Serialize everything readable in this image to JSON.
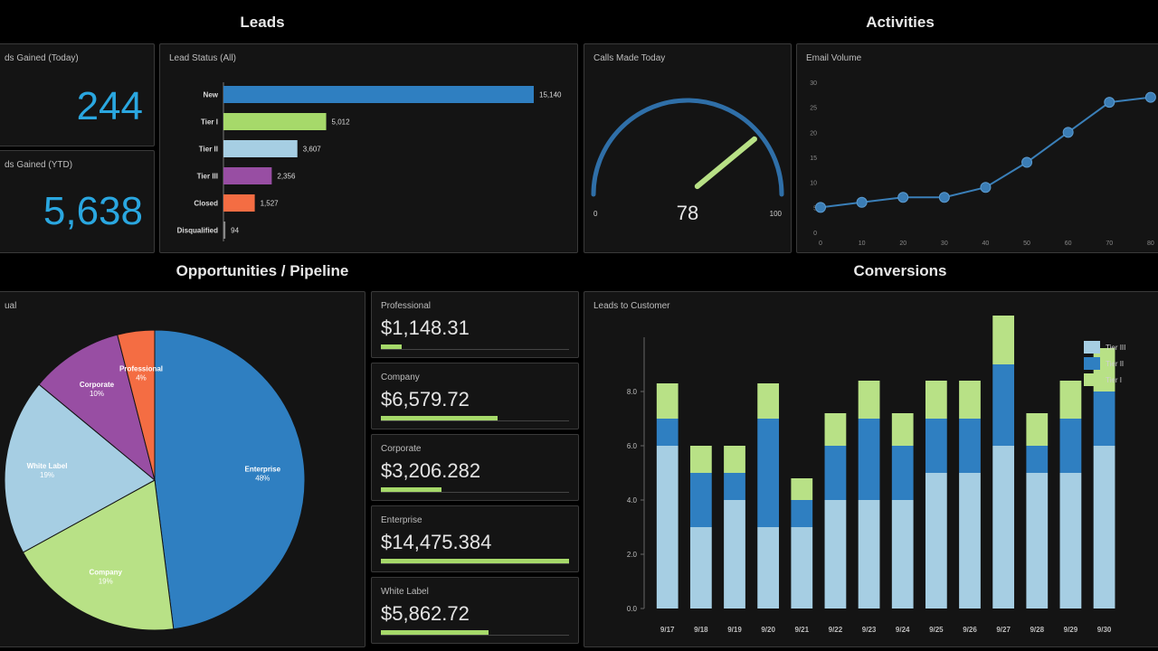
{
  "sections": {
    "leads": "Leads",
    "activities": "Activities",
    "opportunities": "Opportunities / Pipeline",
    "conversions": "Conversions"
  },
  "kpis": {
    "today_title": "ds Gained (Today)",
    "today_value": "244",
    "ytd_title": "ds Gained (YTD)",
    "ytd_value": "5,638"
  },
  "lead_status": {
    "title": "Lead Status (All)",
    "chart_data": {
      "type": "bar",
      "orientation": "horizontal",
      "categories": [
        "New",
        "Tier I",
        "Tier II",
        "Tier III",
        "Closed",
        "Disqualified"
      ],
      "values": [
        15140,
        5012,
        3607,
        2356,
        1527,
        94
      ],
      "value_labels": [
        "15,140",
        "5,012",
        "3,607",
        "2,356",
        "1,527",
        "94"
      ],
      "colors": [
        "#2f7fc1",
        "#a6d96a",
        "#a6cee3",
        "#984ea3",
        "#f46d43",
        "#888888"
      ]
    }
  },
  "calls": {
    "title": "Calls Made Today",
    "chart_data": {
      "type": "gauge",
      "value": 78,
      "min": 0,
      "max": 100,
      "min_label": "0",
      "max_label": "100",
      "value_label": "78"
    }
  },
  "email": {
    "title": "Email Volume",
    "chart_data": {
      "type": "line",
      "x": [
        0,
        10,
        20,
        30,
        40,
        50,
        60,
        70,
        80
      ],
      "x_tick_labels": [
        "0",
        "10",
        "20",
        "30",
        "40",
        "50",
        "60",
        "70",
        "80"
      ],
      "y_tick_labels": [
        "0",
        "5",
        "10",
        "15",
        "20",
        "25",
        "30"
      ],
      "ylim": [
        0,
        30
      ],
      "points": [
        {
          "x": 0,
          "y": 5
        },
        {
          "x": 10,
          "y": 6
        },
        {
          "x": 20,
          "y": 7
        },
        {
          "x": 30,
          "y": 7
        },
        {
          "x": 40,
          "y": 9
        },
        {
          "x": 50,
          "y": 14
        },
        {
          "x": 60,
          "y": 20
        },
        {
          "x": 70,
          "y": 26
        },
        {
          "x": 80,
          "y": 27
        }
      ]
    }
  },
  "pipeline_pie": {
    "title": "ual",
    "chart_data": {
      "type": "pie",
      "slices": [
        {
          "name": "Enterprise",
          "label": "Enterprise",
          "pct_label": "48%",
          "value": 48,
          "color": "#2f7fc1"
        },
        {
          "name": "Company",
          "label": "Company",
          "pct_label": "19%",
          "value": 19,
          "color": "#b8e186"
        },
        {
          "name": "White Label",
          "label": "White Label",
          "pct_label": "19%",
          "value": 19,
          "color": "#a6cee3"
        },
        {
          "name": "Corporate",
          "label": "Corporate",
          "pct_label": "10%",
          "value": 10,
          "color": "#984ea3"
        },
        {
          "name": "Professional",
          "label": "Professional",
          "pct_label": "4%",
          "value": 4,
          "color": "#f46d43"
        }
      ]
    }
  },
  "opportunities": [
    {
      "label": "Professional",
      "value": "$1,148.31",
      "fill": 0.11
    },
    {
      "label": "Company",
      "value": "$6,579.72",
      "fill": 0.62
    },
    {
      "label": "Corporate",
      "value": "$3,206.282",
      "fill": 0.32
    },
    {
      "label": "Enterprise",
      "value": "$14,475.384",
      "fill": 1.0
    },
    {
      "label": "White Label",
      "value": "$5,862.72",
      "fill": 0.57
    }
  ],
  "conversions": {
    "title": "Leads to Customer",
    "chart_data": {
      "type": "bar",
      "stacked": true,
      "categories": [
        "9/17",
        "9/18",
        "9/19",
        "9/20",
        "9/21",
        "9/22",
        "9/23",
        "9/24",
        "9/25",
        "9/26",
        "9/27",
        "9/28",
        "9/29",
        "9/30"
      ],
      "ylim": [
        0,
        10
      ],
      "y_tick_labels": [
        "0.0",
        "2.0",
        "4.0",
        "6.0",
        "8.0"
      ],
      "y_ticks": [
        0,
        2,
        4,
        6,
        8
      ],
      "series": [
        {
          "name": "Tier III",
          "color": "#a6cee3",
          "values": [
            6,
            3,
            4,
            3,
            3,
            4,
            4,
            4,
            5,
            5,
            6,
            5,
            5,
            6
          ]
        },
        {
          "name": "Tier II",
          "color": "#2f7fc1",
          "values": [
            1,
            2,
            1,
            4,
            1,
            2,
            3,
            2,
            2,
            2,
            3,
            1,
            2,
            2
          ]
        },
        {
          "name": "Tier I",
          "color": "#b8e186",
          "values": [
            1.3,
            1,
            1,
            1.3,
            0.8,
            1.2,
            1.4,
            1.2,
            1.4,
            1.4,
            1.8,
            1.2,
            1.4,
            1.6
          ]
        }
      ]
    }
  }
}
